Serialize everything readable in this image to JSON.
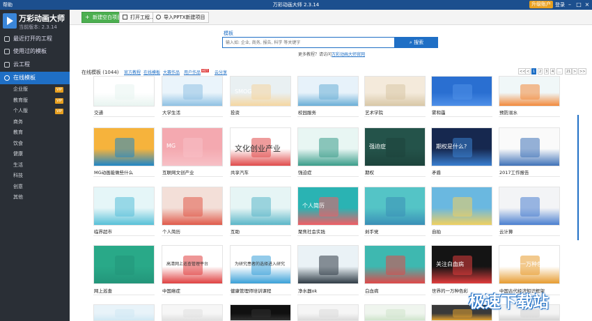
{
  "titlebar": {
    "help": "帮助",
    "title": "万彩动画大师 2.3.14",
    "upgrade": "升级账户",
    "login": "登录",
    "min": "–",
    "max": "□",
    "close": "×"
  },
  "app": {
    "name": "万彩动画大师",
    "version": "当前版本: 2.3.14"
  },
  "sidebar": {
    "items": [
      "最近打开的工程",
      "使用过的模板",
      "云工程",
      "在线模板"
    ],
    "subs": [
      {
        "label": "企业版",
        "vip": "VIP"
      },
      {
        "label": "教育版",
        "vip": "VIP"
      },
      {
        "label": "个人版",
        "vip": "VIP"
      },
      {
        "label": "商务"
      },
      {
        "label": "教育"
      },
      {
        "label": "饮食"
      },
      {
        "label": "健康"
      },
      {
        "label": "生活"
      },
      {
        "label": "科技"
      },
      {
        "label": "创意"
      },
      {
        "label": "其他"
      }
    ]
  },
  "toolbar": {
    "new_blank": "新建空白项目",
    "open": "打开工程...",
    "import": "导入PPTX新建项目"
  },
  "search": {
    "label": "模板",
    "placeholder": "输入如: 企业, 商务, 报告, 科学 等关键字",
    "button": "搜索"
  },
  "more": {
    "prefix": "更多教程？请访问",
    "link": "万彩动画大师官网"
  },
  "filter": {
    "count": "在线模板 (1044)",
    "tabs": [
      "官方教程",
      "在线模板",
      "大赛作品",
      "用户作品",
      "云分享"
    ],
    "hot": "HOT"
  },
  "pager": [
    "<<",
    "<",
    "1",
    "2",
    "3",
    "4",
    "...",
    "21",
    ">",
    ">>"
  ],
  "templates": [
    "交通",
    "大学生活",
    "投资",
    "校园服务",
    "艺术学院",
    "雾和霾",
    "预防溺水",
    "MG动画能做些什么",
    "互联网文创产业",
    "共享汽车",
    "强迫症",
    "期权",
    "矛盾",
    "2017工作报告",
    "临界超市",
    "个人简历",
    "互助",
    "聚焦社会实践",
    "剁手党",
    "自拍",
    "云计算",
    "网上巡查",
    "中国癌症",
    "健康管理师培训课程",
    "净水器ok",
    "白血病",
    "世界的一万种色彩",
    "中国古代经济知识框架",
    "",
    "",
    "",
    "",
    "",
    "",
    ""
  ],
  "thumb_text": {
    "t2": "SMOG",
    "t8": "MG",
    "t9": "文化创业产业",
    "t11": "强迫症",
    "t12": "期权是什么?",
    "t22": "高清网上巡查管理平台",
    "t23": "为研究患者的选择进入研究",
    "t27": "世界的一万种色彩",
    "t26": "关注白血病",
    "t17": "个人简历"
  },
  "watermark": "极速下载站",
  "colors": {
    "accent": "#1f6fc5",
    "sidebar": "#2a2f36",
    "titlebar": "#1c4f8e",
    "green": "#4caf50"
  }
}
